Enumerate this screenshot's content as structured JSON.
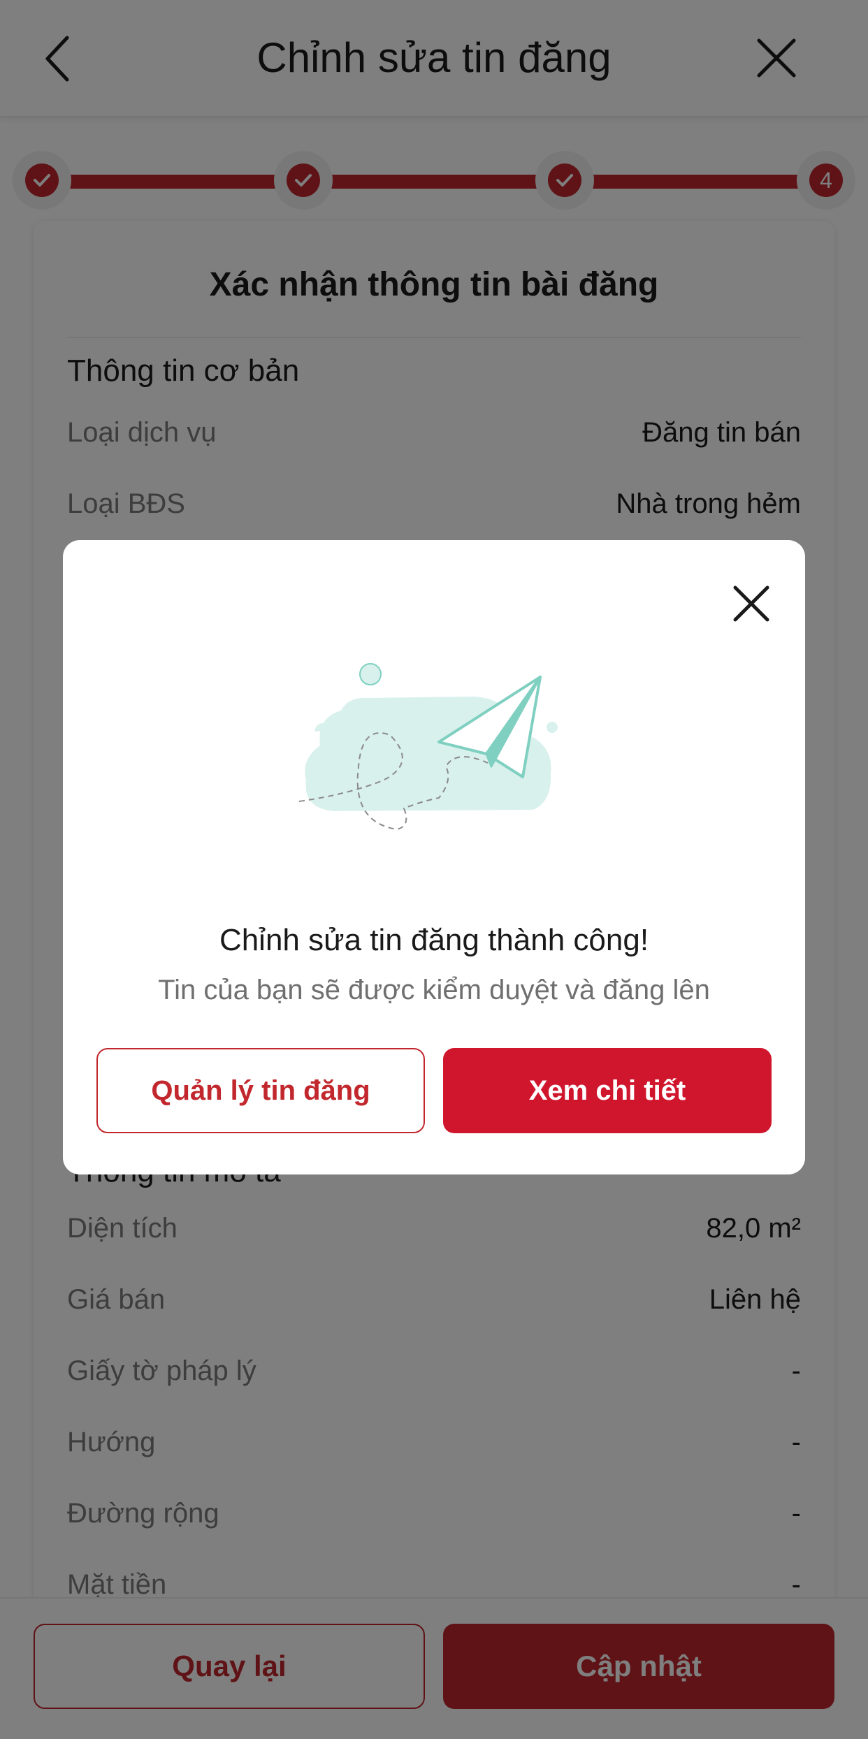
{
  "header": {
    "title": "Chỉnh sửa tin đăng"
  },
  "stepper": {
    "current_step_label": "4",
    "completed_steps": 3,
    "total_steps": 4
  },
  "card": {
    "title": "Xác nhận thông tin bài đăng",
    "basic_section": "Thông tin cơ bản",
    "basic_rows": [
      {
        "label": "Loại dịch vụ",
        "value": "Đăng tin bán"
      },
      {
        "label": "Loại BĐS",
        "value": "Nhà trong hẻm"
      }
    ],
    "description_section": "Thông tin mô tả",
    "description_rows": [
      {
        "label": "Diện tích",
        "value": "82,0 m²"
      },
      {
        "label": "Giá bán",
        "value": "Liên hệ"
      },
      {
        "label": "Giấy tờ pháp lý",
        "value": "-"
      },
      {
        "label": "Hướng",
        "value": "-"
      },
      {
        "label": "Đường rộng",
        "value": "-"
      },
      {
        "label": "Mặt tiền",
        "value": "-"
      }
    ]
  },
  "bottom_bar": {
    "back_label": "Quay lại",
    "update_label": "Cập nhật"
  },
  "modal": {
    "title": "Chỉnh sửa tin đăng thành công!",
    "subtitle": "Tin của bạn sẽ được kiểm duyệt và đăng lên",
    "manage_label": "Quản lý tin đăng",
    "detail_label": "Xem chi tiết",
    "illustration_icon": "paper-plane-icon"
  },
  "colors": {
    "accent": "#c1272d",
    "modal_primary": "#d0162d",
    "illustration": "#7fd0c1"
  }
}
